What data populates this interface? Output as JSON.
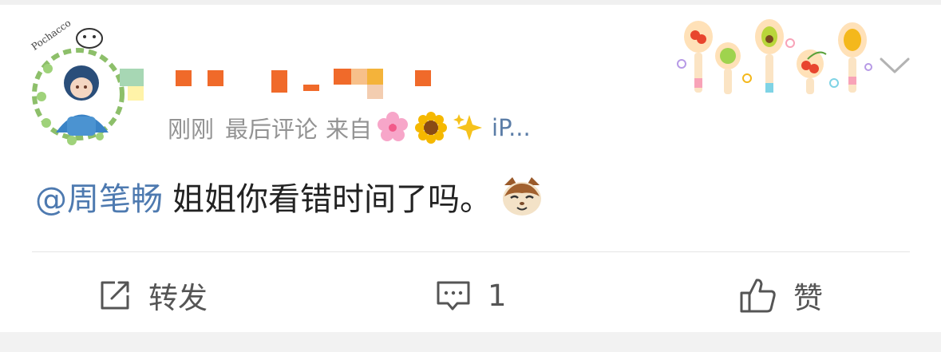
{
  "post": {
    "meta": {
      "time": "刚刚",
      "label": "最后评论",
      "source_label": "来自",
      "source_text": "iP..."
    },
    "comment": {
      "mention": "@周笔畅",
      "text": "姐姐你看错时间了吗。"
    },
    "actions": {
      "repost_label": "转发",
      "comment_count": "1",
      "like_label": "赞"
    },
    "avatar": {
      "badge_text": "Pochacco"
    }
  },
  "colors": {
    "link": "#4e7ab0",
    "meta": "#939393",
    "text": "#222222",
    "divider": "#e6e6e6",
    "background": "#f2f2f2"
  },
  "icons": [
    "avatar-image",
    "sakura-emoji",
    "sunflower-emoji",
    "sparkles-emoji",
    "cat-emoji",
    "repost-icon",
    "comment-icon",
    "like-icon",
    "chevron-down-icon",
    "spoon-decoration"
  ]
}
